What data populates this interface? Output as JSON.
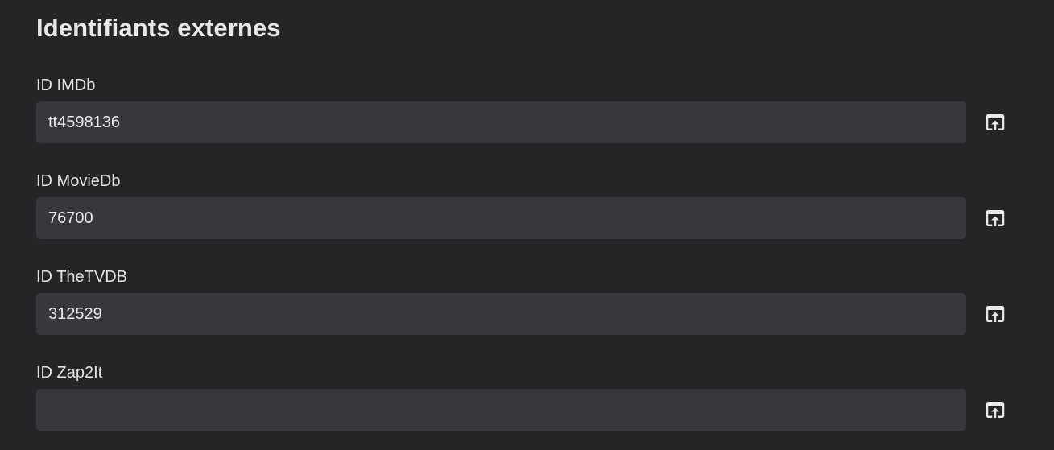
{
  "section": {
    "title": "Identifiants externes"
  },
  "fields": [
    {
      "label": "ID IMDb",
      "value": "tt4598136",
      "icon": "open-in-browser-icon"
    },
    {
      "label": "ID MovieDb",
      "value": "76700",
      "icon": "open-in-browser-icon"
    },
    {
      "label": "ID TheTVDB",
      "value": "312529",
      "icon": "open-in-browser-icon"
    },
    {
      "label": "ID Zap2It",
      "value": "",
      "icon": "open-in-browser-icon"
    }
  ],
  "colors": {
    "background": "#252527",
    "input_background": "#37383c",
    "text": "#e6e6e6"
  }
}
